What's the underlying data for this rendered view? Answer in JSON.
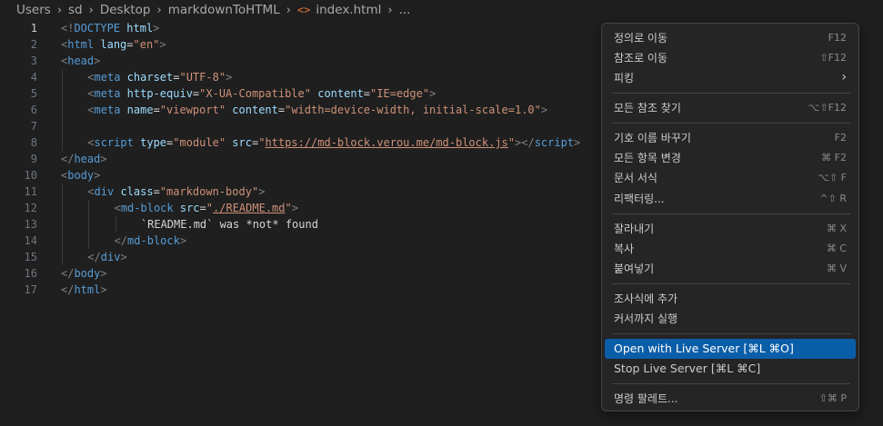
{
  "breadcrumb": {
    "items": [
      "Users",
      "sd",
      "Desktop",
      "markdownToHTML"
    ],
    "file_icon": "<>",
    "file": "index.html",
    "ellipsis": "..."
  },
  "editor": {
    "active_line": 1,
    "lines": [
      {
        "n": "1",
        "indent": 0,
        "tokens": [
          [
            "br",
            "<!"
          ],
          [
            "tag",
            "DOCTYPE"
          ],
          [
            "text",
            " "
          ],
          [
            "attr",
            "html"
          ],
          [
            "br",
            ">"
          ]
        ]
      },
      {
        "n": "2",
        "indent": 0,
        "tokens": [
          [
            "br",
            "<"
          ],
          [
            "tag",
            "html"
          ],
          [
            "text",
            " "
          ],
          [
            "attr",
            "lang"
          ],
          [
            "text",
            "="
          ],
          [
            "val",
            "\"en\""
          ],
          [
            "br",
            ">"
          ]
        ]
      },
      {
        "n": "3",
        "indent": 0,
        "tokens": [
          [
            "br",
            "<"
          ],
          [
            "tag",
            "head"
          ],
          [
            "br",
            ">"
          ]
        ]
      },
      {
        "n": "4",
        "indent": 1,
        "tokens": [
          [
            "br",
            "<"
          ],
          [
            "tag",
            "meta"
          ],
          [
            "text",
            " "
          ],
          [
            "attr",
            "charset"
          ],
          [
            "text",
            "="
          ],
          [
            "val",
            "\"UTF-8\""
          ],
          [
            "br",
            ">"
          ]
        ]
      },
      {
        "n": "5",
        "indent": 1,
        "tokens": [
          [
            "br",
            "<"
          ],
          [
            "tag",
            "meta"
          ],
          [
            "text",
            " "
          ],
          [
            "attr",
            "http-equiv"
          ],
          [
            "text",
            "="
          ],
          [
            "val",
            "\"X-UA-Compatible\""
          ],
          [
            "text",
            " "
          ],
          [
            "attr",
            "content"
          ],
          [
            "text",
            "="
          ],
          [
            "val",
            "\"IE=edge\""
          ],
          [
            "br",
            ">"
          ]
        ]
      },
      {
        "n": "6",
        "indent": 1,
        "tokens": [
          [
            "br",
            "<"
          ],
          [
            "tag",
            "meta"
          ],
          [
            "text",
            " "
          ],
          [
            "attr",
            "name"
          ],
          [
            "text",
            "="
          ],
          [
            "val",
            "\"viewport\""
          ],
          [
            "text",
            " "
          ],
          [
            "attr",
            "content"
          ],
          [
            "text",
            "="
          ],
          [
            "val",
            "\"width=device-width, initial-scale=1.0\""
          ],
          [
            "br",
            ">"
          ]
        ]
      },
      {
        "n": "7",
        "indent": 1,
        "tokens": []
      },
      {
        "n": "8",
        "indent": 1,
        "tokens": [
          [
            "br",
            "<"
          ],
          [
            "tag",
            "script"
          ],
          [
            "text",
            " "
          ],
          [
            "attr",
            "type"
          ],
          [
            "text",
            "="
          ],
          [
            "val",
            "\"module\""
          ],
          [
            "text",
            " "
          ],
          [
            "attr",
            "src"
          ],
          [
            "text",
            "="
          ],
          [
            "val",
            "\""
          ],
          [
            "url",
            "https://md-block.verou.me/md-block.js"
          ],
          [
            "val",
            "\""
          ],
          [
            "br",
            "></"
          ],
          [
            "tag",
            "script"
          ],
          [
            "br",
            ">"
          ]
        ]
      },
      {
        "n": "9",
        "indent": 0,
        "tokens": [
          [
            "br",
            "</"
          ],
          [
            "tag",
            "head"
          ],
          [
            "br",
            ">"
          ]
        ]
      },
      {
        "n": "10",
        "indent": 0,
        "tokens": [
          [
            "br",
            "<"
          ],
          [
            "tag",
            "body"
          ],
          [
            "br",
            ">"
          ]
        ]
      },
      {
        "n": "11",
        "indent": 1,
        "tokens": [
          [
            "br",
            "<"
          ],
          [
            "tag",
            "div"
          ],
          [
            "text",
            " "
          ],
          [
            "attr",
            "class"
          ],
          [
            "text",
            "="
          ],
          [
            "val",
            "\"markdown-body\""
          ],
          [
            "br",
            ">"
          ]
        ]
      },
      {
        "n": "12",
        "indent": 2,
        "tokens": [
          [
            "br",
            "<"
          ],
          [
            "tag",
            "md-block"
          ],
          [
            "text",
            " "
          ],
          [
            "attr",
            "src"
          ],
          [
            "text",
            "="
          ],
          [
            "val",
            "\""
          ],
          [
            "url",
            "./README.md"
          ],
          [
            "val",
            "\""
          ],
          [
            "br",
            ">"
          ]
        ]
      },
      {
        "n": "13",
        "indent": 3,
        "tokens": [
          [
            "text",
            "`README.md` was *not* found"
          ]
        ]
      },
      {
        "n": "14",
        "indent": 2,
        "tokens": [
          [
            "br",
            "</"
          ],
          [
            "tag",
            "md-block"
          ],
          [
            "br",
            ">"
          ]
        ]
      },
      {
        "n": "15",
        "indent": 1,
        "tokens": [
          [
            "br",
            "</"
          ],
          [
            "tag",
            "div"
          ],
          [
            "br",
            ">"
          ]
        ]
      },
      {
        "n": "16",
        "indent": 0,
        "tokens": [
          [
            "br",
            "</"
          ],
          [
            "tag",
            "body"
          ],
          [
            "br",
            ">"
          ]
        ]
      },
      {
        "n": "17",
        "indent": 0,
        "tokens": [
          [
            "br",
            "</"
          ],
          [
            "tag",
            "html"
          ],
          [
            "br",
            ">"
          ]
        ]
      }
    ]
  },
  "context_menu": {
    "items": [
      {
        "label": "정의로 이동",
        "key": "F12"
      },
      {
        "label": "참조로 이동",
        "key": "⇧F12"
      },
      {
        "label": "피킹",
        "key": "",
        "submenu": true
      },
      {
        "separator": true
      },
      {
        "label": "모든 참조 찾기",
        "key": "⌥⇧F12"
      },
      {
        "separator": true
      },
      {
        "label": "기호 이름 바꾸기",
        "key": "F2"
      },
      {
        "label": "모든 항목 변경",
        "key": "⌘ F2"
      },
      {
        "label": "문서 서식",
        "key": "⌥⇧ F"
      },
      {
        "label": "리팩터링...",
        "key": "^⇧ R"
      },
      {
        "separator": true
      },
      {
        "label": "잘라내기",
        "key": "⌘ X"
      },
      {
        "label": "복사",
        "key": "⌘ C"
      },
      {
        "label": "붙여넣기",
        "key": "⌘ V"
      },
      {
        "separator": true
      },
      {
        "label": "조사식에 추가",
        "key": ""
      },
      {
        "label": "커서까지 실행",
        "key": ""
      },
      {
        "separator": true
      },
      {
        "label": "Open with Live Server [⌘L ⌘O]",
        "key": "",
        "highlighted": true,
        "plain": true
      },
      {
        "label": "Stop Live Server [⌘L ⌘C]",
        "key": "",
        "plain": true
      },
      {
        "separator": true
      },
      {
        "label": "명령 팔레트...",
        "key": "⇧⌘ P"
      }
    ]
  },
  "colors": {
    "editor_bg": "#1f1f1f",
    "menu_bg": "#252526",
    "menu_highlight": "#0a5ea8",
    "tag": "#569cd6",
    "attribute": "#9cdcfe",
    "string": "#ce9178"
  },
  "icons": {
    "breadcrumb_separator": "chevron-right-icon",
    "file": "html-file-icon",
    "submenu": "chevron-right-icon"
  }
}
